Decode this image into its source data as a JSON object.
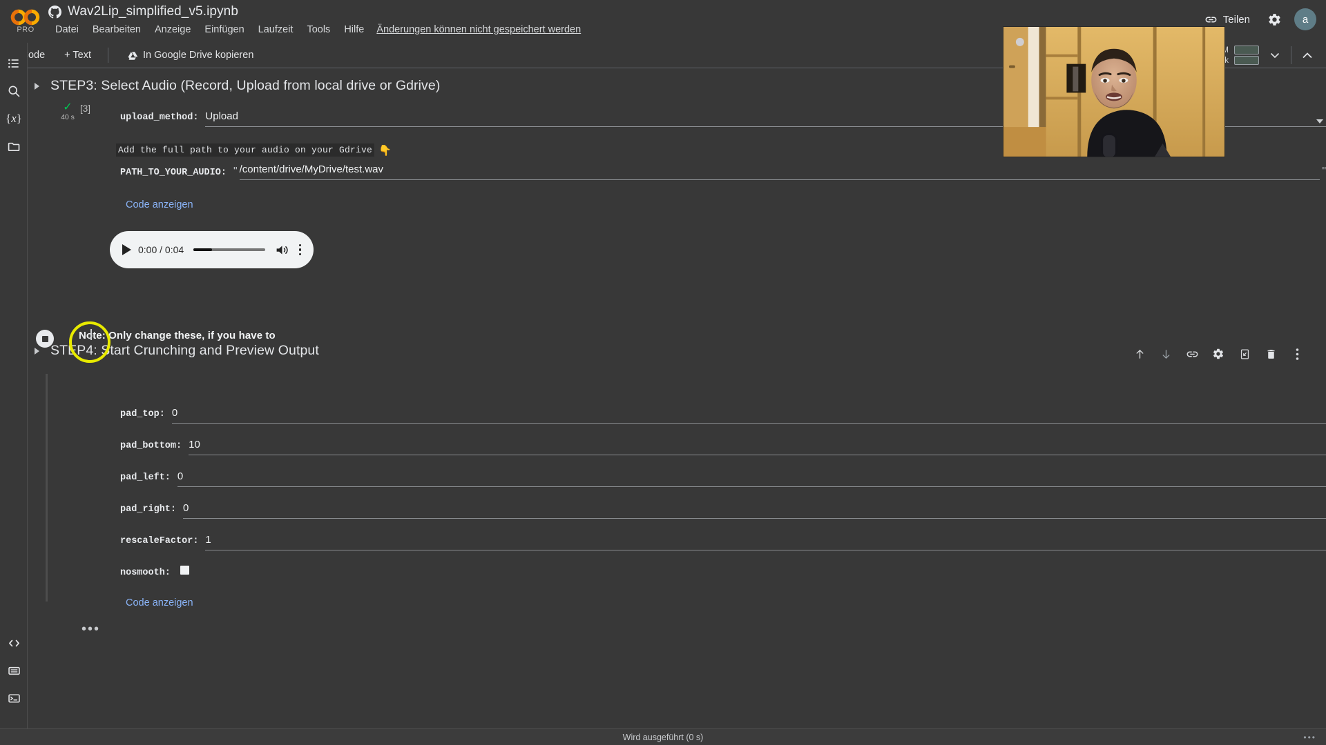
{
  "app": {
    "brand": "CO",
    "brand_tier": "PRO",
    "notebook_title": "Wav2Lip_simplified_v5.ipynb",
    "github_icon": "github-icon"
  },
  "menubar": {
    "items": [
      "Datei",
      "Bearbeiten",
      "Anzeige",
      "Einfügen",
      "Laufzeit",
      "Tools",
      "Hilfe"
    ],
    "save_state": "Änderungen können nicht gespeichert werden"
  },
  "topbar_right": {
    "share_label": "Teilen",
    "link_icon": "link-icon",
    "settings_icon": "gear-icon",
    "avatar_initial": "a"
  },
  "toolbar": {
    "add_code": "+ Code",
    "add_text": "+ Text",
    "copy_to_drive": "In Google Drive kopieren",
    "drive_icon": "google-drive-icon"
  },
  "resources": {
    "ram_label": "RAM",
    "disk_label": "ufwerk",
    "caret_icon": "chevron-down-icon",
    "collapse_icon": "chevron-up-icon"
  },
  "sidebar": {
    "top_items": [
      {
        "name": "table-of-contents-icon",
        "label": "Inhaltsverzeichnis"
      },
      {
        "name": "search-icon",
        "label": "Suchen"
      },
      {
        "name": "variables-icon",
        "label": "Variablen"
      },
      {
        "name": "files-icon",
        "label": "Dateien"
      }
    ],
    "bottom_items": [
      {
        "name": "code-snippets-icon",
        "label": "Code-Snippets"
      },
      {
        "name": "command-palette-icon",
        "label": "Befehlspalette"
      },
      {
        "name": "terminal-icon",
        "label": "Terminal"
      }
    ],
    "expander_icon": "expand-sidebar-icon"
  },
  "step3": {
    "title": "STEP3: Select Audio (Record, Upload from local drive or Gdrive)",
    "exec_count": "[3]",
    "run_time": "40 s",
    "status_icon": "check-icon",
    "fields": [
      {
        "label": "upload_method:",
        "value": "Upload",
        "type": "select"
      }
    ],
    "comment": "Add the full path to your audio on your Gdrive",
    "comment_emoji": "👇",
    "path_field": {
      "label": "PATH_TO_YOUR_AUDIO:",
      "value": "/content/drive/MyDrive/test.wav",
      "quote": "\""
    },
    "show_code": "Code anzeigen"
  },
  "audio_player": {
    "play_icon": "play-icon",
    "time": "0:00 / 0:04",
    "volume_icon": "volume-icon",
    "more_icon": "more-vertical-icon",
    "progress_percent": 26
  },
  "cell_toolbar": {
    "buttons": [
      {
        "name": "move-cell-up-icon",
        "label": "Zelle nach oben"
      },
      {
        "name": "move-cell-down-icon",
        "label": "Zelle nach unten"
      },
      {
        "name": "link-to-cell-icon",
        "label": "Link zur Zelle"
      },
      {
        "name": "cell-settings-icon",
        "label": "Einstellungen"
      },
      {
        "name": "mirror-cell-icon",
        "label": "Zelle spiegeln"
      },
      {
        "name": "delete-cell-icon",
        "label": "Zelle löschen"
      },
      {
        "name": "cell-more-options-icon",
        "label": "Weitere Optionen"
      }
    ]
  },
  "step4": {
    "title": "STEP4: Start Crunching and Preview Output",
    "run_icon": "stop-button-icon",
    "note": "Note: Only change these, if you have to",
    "fields": [
      {
        "label": "pad_top:",
        "value": "0"
      },
      {
        "label": "pad_bottom:",
        "value": "10"
      },
      {
        "label": "pad_left:",
        "value": "0"
      },
      {
        "label": "pad_right:",
        "value": "0"
      },
      {
        "label": "rescaleFactor:",
        "value": "1"
      }
    ],
    "checkbox_field": {
      "label": "nosmooth:",
      "checked": false
    },
    "show_code": "Code anzeigen",
    "more_cell_actions": "•••"
  },
  "annotation": {
    "highlight_color": "#e8ea00",
    "shape": "circle"
  },
  "statusbar": {
    "text": "Wird ausgeführt (0 s)",
    "right_dots": "•••"
  },
  "colors": {
    "background": "#383838",
    "link": "#8ab4f8",
    "accent_green": "#00c853",
    "avatar": "#5f7d87"
  }
}
